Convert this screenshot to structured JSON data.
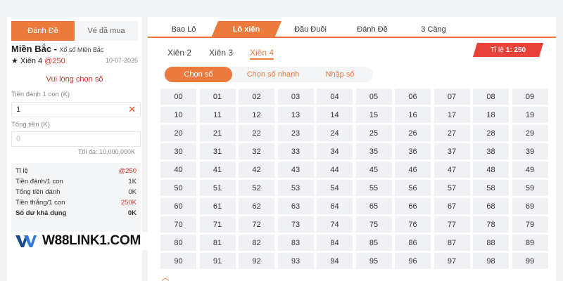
{
  "left_panel": {
    "tabs": [
      {
        "label": "Đánh Đề",
        "active": true
      },
      {
        "label": "Vé đã mua",
        "active": false
      }
    ],
    "region": "Miền Bắc -",
    "lottery_name": "Xổ số Miền Bắc",
    "bet_type": "Xiên 4",
    "bet_odds": "@250",
    "date": "10-07-2025",
    "warning": "Vui lòng chọn số",
    "stake_label": "Tiền đánh 1 con (K)",
    "stake_value": "1",
    "total_label": "Tổng tiền (K)",
    "total_placeholder": "0",
    "max_note": "Tối đa: 10,000,000K",
    "summary": [
      {
        "label": "Tỉ lệ",
        "value": "@250",
        "red": true,
        "bold": false
      },
      {
        "label": "Tiền đánh/1 con",
        "value": "1K",
        "red": false,
        "bold": false
      },
      {
        "label": "Tổng tiền đánh",
        "value": "0K",
        "red": false,
        "bold": false
      },
      {
        "label": "Tiền thắng/1 con",
        "value": "250K",
        "red": true,
        "bold": false
      },
      {
        "label": "Số dư khả dụng",
        "value": "0K",
        "red": false,
        "bold": true
      }
    ]
  },
  "watermark": {
    "text": "W88LINK1.COM"
  },
  "game_tabs": [
    {
      "label": "Bao Lô",
      "active": false
    },
    {
      "label": "Lô xiên",
      "active": true
    },
    {
      "label": "Đầu Đuôi",
      "active": false
    },
    {
      "label": "Đánh Đề",
      "active": false
    },
    {
      "label": "3 Càng",
      "active": false
    }
  ],
  "sub_tabs": [
    {
      "label": "Xiên 2",
      "active": false
    },
    {
      "label": "Xiên 3",
      "active": false
    },
    {
      "label": "Xiên 4",
      "active": true
    }
  ],
  "ratio_badge": {
    "label": "Tỉ lệ",
    "value": "1: 250"
  },
  "modes": [
    {
      "label": "Chọn số",
      "active": true
    },
    {
      "label": "Chọn số nhanh",
      "active": false
    },
    {
      "label": "Nhập số",
      "active": false
    }
  ],
  "numbers": [
    "00",
    "01",
    "02",
    "03",
    "04",
    "05",
    "06",
    "07",
    "08",
    "09",
    "10",
    "11",
    "12",
    "13",
    "14",
    "15",
    "16",
    "17",
    "18",
    "19",
    "20",
    "21",
    "22",
    "23",
    "24",
    "25",
    "26",
    "27",
    "28",
    "29",
    "30",
    "31",
    "32",
    "33",
    "34",
    "35",
    "36",
    "37",
    "38",
    "39",
    "40",
    "41",
    "42",
    "43",
    "44",
    "45",
    "46",
    "47",
    "48",
    "49",
    "50",
    "51",
    "52",
    "53",
    "54",
    "55",
    "56",
    "57",
    "58",
    "59",
    "60",
    "61",
    "62",
    "63",
    "64",
    "65",
    "66",
    "67",
    "68",
    "69",
    "70",
    "71",
    "72",
    "73",
    "74",
    "75",
    "76",
    "77",
    "78",
    "79",
    "80",
    "81",
    "82",
    "83",
    "84",
    "85",
    "86",
    "87",
    "88",
    "89",
    "90",
    "91",
    "92",
    "93",
    "94",
    "95",
    "96",
    "97",
    "98",
    "99"
  ],
  "colors": {
    "accent": "#ec7a3c",
    "danger": "#d8372b",
    "badge": "#e8413a",
    "cell_bg": "#f0f1f4"
  }
}
